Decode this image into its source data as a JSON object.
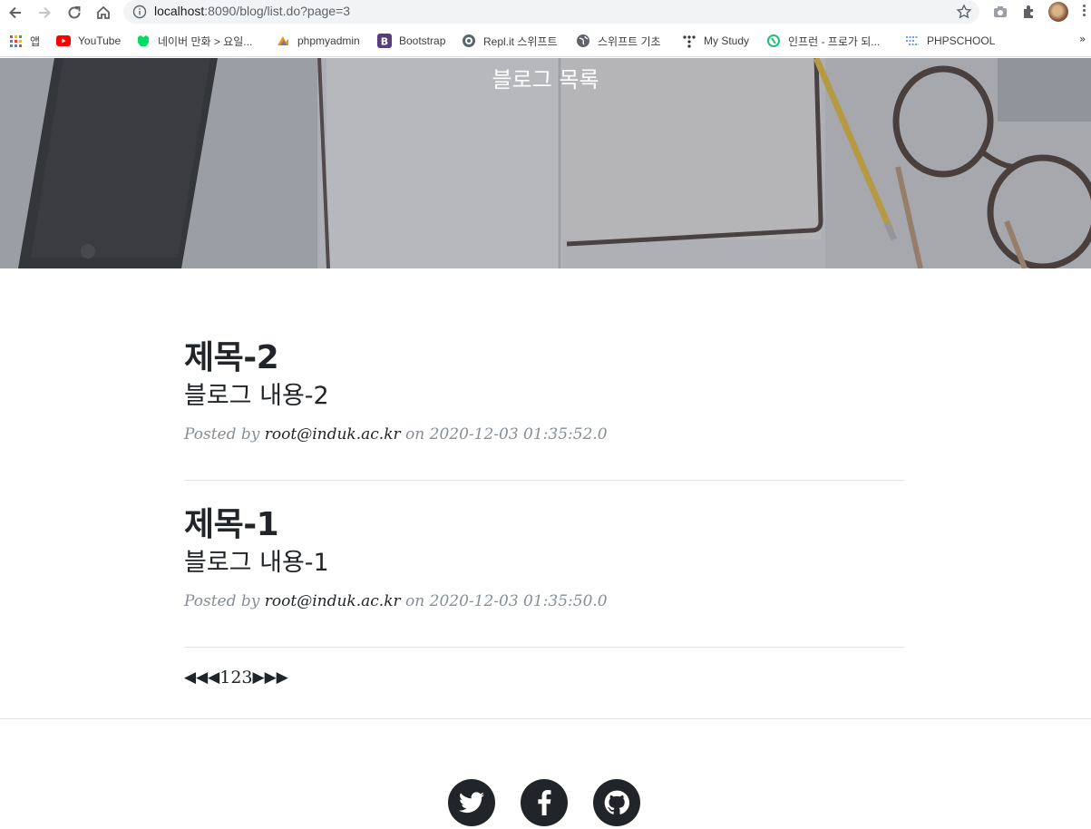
{
  "browser": {
    "url_host": "localhost",
    "url_rest": ":8090/blog/list.do?page=3"
  },
  "bookmarks": [
    {
      "label": "앱",
      "icon": "apps-grid-icon"
    },
    {
      "label": "YouTube",
      "icon": "youtube-icon"
    },
    {
      "label": "네이버 만화 > 요일...",
      "icon": "naver-webtoon-icon"
    },
    {
      "label": "phpmyadmin",
      "icon": "phpmyadmin-icon"
    },
    {
      "label": "Bootstrap",
      "icon": "bootstrap-icon"
    },
    {
      "label": "Repl.it 스위프트",
      "icon": "replit-icon"
    },
    {
      "label": "스위프트 기초",
      "icon": "globe-icon"
    },
    {
      "label": "My Study",
      "icon": "dots-icon"
    },
    {
      "label": "인프런 - 프로가 되...",
      "icon": "inflearn-icon"
    },
    {
      "label": "PHPSCHOOL",
      "icon": "phpschool-icon"
    }
  ],
  "bookmarks_more": "»",
  "header": {
    "title": "블로그 목록"
  },
  "posts": [
    {
      "title": "제목-2",
      "subtitle": "블로그 내용-2",
      "posted_by": "Posted by",
      "author": "root@induk.ac.kr",
      "on": "on",
      "date": "2020-12-03 01:35:52.0"
    },
    {
      "title": "제목-1",
      "subtitle": "블로그 내용-1",
      "posted_by": "Posted by",
      "author": "root@induk.ac.kr",
      "on": "on",
      "date": "2020-12-03 01:35:50.0"
    }
  ],
  "pagination": {
    "first": "◀",
    "prev_block": "◀",
    "prev": "◀",
    "pages": [
      "1",
      "2",
      "3"
    ],
    "next": "▶",
    "next_block": "▶",
    "last": "▶"
  },
  "footer": {
    "social": [
      {
        "icon": "twitter-icon"
      },
      {
        "icon": "facebook-icon"
      },
      {
        "icon": "github-icon"
      }
    ]
  },
  "colors": {
    "text": "#212529",
    "muted": "#868e96",
    "hero_overlay": "#7d7f83"
  }
}
